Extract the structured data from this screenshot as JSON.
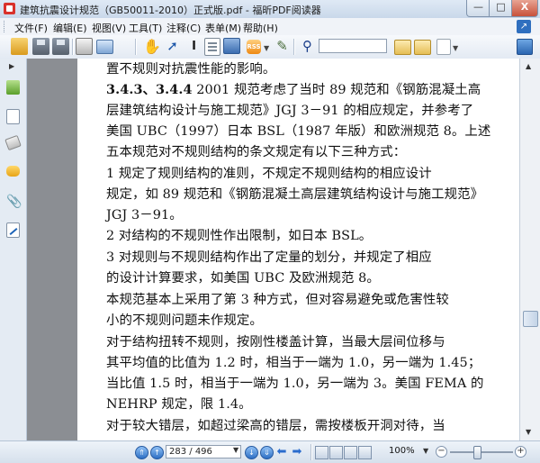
{
  "window": {
    "title": "建筑抗震设计规范（GB50011-2010）正式版.pdf - 福昕PDF阅读器",
    "min_label": "—",
    "max_label": "□",
    "close_label": "X"
  },
  "menu": {
    "items": [
      "文件(F)",
      "编辑(E)",
      "视图(V)",
      "工具(T)",
      "注释(C)",
      "表单(M)",
      "帮助(H)"
    ]
  },
  "toolbar": {
    "search_value": "",
    "rss_label": "RSS"
  },
  "document": {
    "lines": [
      {
        "bold": "",
        "text": "置不规则对抗震性能的影响。"
      },
      {
        "bold": "3.4.3、3.4.4",
        "text": "  2001 规范考虑了当时 89 规范和《钢筋混凝土高"
      },
      {
        "bold": "",
        "text": "层建筑结构设计与施工规范》JGJ 3－91 的相应规定，并参考了"
      },
      {
        "bold": "",
        "text": "美国 UBC（1997）日本 BSL（1987 年版）和欧洲规范 8。上述"
      },
      {
        "bold": "",
        "text": "五本规范对不规则结构的条文规定有以下三种方式："
      },
      {
        "bold": "",
        "text": "    1  规定了规则结构的准则，不规定不规则结构的相应设计"
      },
      {
        "bold": "",
        "text": "规定，如 89 规范和《钢筋混凝土高层建筑结构设计与施工规范》"
      },
      {
        "bold": "",
        "text": "JGJ 3－91。"
      },
      {
        "bold": "",
        "text": "    2  对结构的不规则性作出限制，如日本 BSL。"
      },
      {
        "bold": "",
        "text": "    3  对规则与不规则结构作出了定量的划分，并规定了相应"
      },
      {
        "bold": "",
        "text": "的设计计算要求，如美国 UBC 及欧洲规范 8。"
      },
      {
        "bold": "",
        "text": "    本规范基本上采用了第 3 种方式，但对容易避免或危害性较"
      },
      {
        "bold": "",
        "text": "小的不规则问题未作规定。"
      },
      {
        "bold": "",
        "text": "    对于结构扭转不规则，按刚性楼盖计算，当最大层间位移与"
      },
      {
        "bold": "",
        "text": "其平均值的比值为 1.2 时，相当于一端为 1.0，另一端为 1.45；"
      },
      {
        "bold": "",
        "text": "当比值 1.5 时，相当于一端为 1.0，另一端为 3。美国 FEMA 的"
      },
      {
        "bold": "",
        "text": "NEHRP 规定，限 1.4。"
      },
      {
        "bold": "",
        "text": "    对于较大错层，如超过梁高的错层，需按楼板开洞对待，当"
      }
    ]
  },
  "status": {
    "page_value": "283 / 496",
    "zoom_value": "100%"
  }
}
